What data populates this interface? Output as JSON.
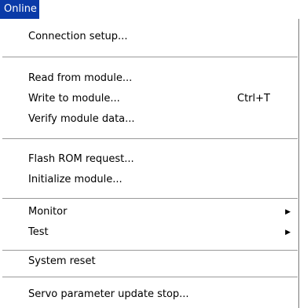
{
  "menubar": {
    "title": "Online"
  },
  "menu": {
    "items": [
      {
        "label": "Connection setup..."
      },
      {
        "label": "Read from module..."
      },
      {
        "label": "Write to module...",
        "shortcut": "Ctrl+T"
      },
      {
        "label": "Verify module data..."
      },
      {
        "label": "Flash ROM request..."
      },
      {
        "label": "Initialize module..."
      },
      {
        "label": "Monitor",
        "arrow": "▶"
      },
      {
        "label": "Test",
        "arrow": "▶"
      },
      {
        "label": "System reset"
      },
      {
        "label": "Servo parameter update stop..."
      }
    ]
  }
}
